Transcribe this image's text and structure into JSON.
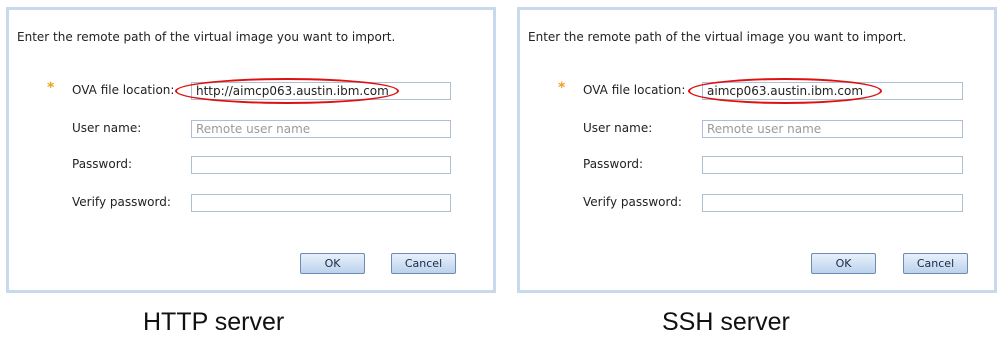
{
  "left_dialog": {
    "intro": "Enter the remote path of the virtual image you want to import.",
    "required_marker": "*",
    "ova_label": "OVA file location:",
    "ova_value": "http://aimcp063.austin.ibm.com",
    "user_label": "User name:",
    "user_placeholder": "Remote user name",
    "password_label": "Password:",
    "verify_label": "Verify password:",
    "ok_label": "OK",
    "cancel_label": "Cancel",
    "caption": "HTTP server"
  },
  "right_dialog": {
    "intro": "Enter the remote path of the virtual image you want to import.",
    "required_marker": "*",
    "ova_label": "OVA file location:",
    "ova_value": "aimcp063.austin.ibm.com",
    "user_label": "User name:",
    "user_placeholder": "Remote user name",
    "password_label": "Password:",
    "verify_label": "Verify password:",
    "ok_label": "OK",
    "cancel_label": "Cancel",
    "caption": "SSH server"
  },
  "colors": {
    "panel_border": "#c8d9ee",
    "required_marker": "#f0a020",
    "highlight": "#dd1111",
    "field_border": "#aebfd4"
  }
}
